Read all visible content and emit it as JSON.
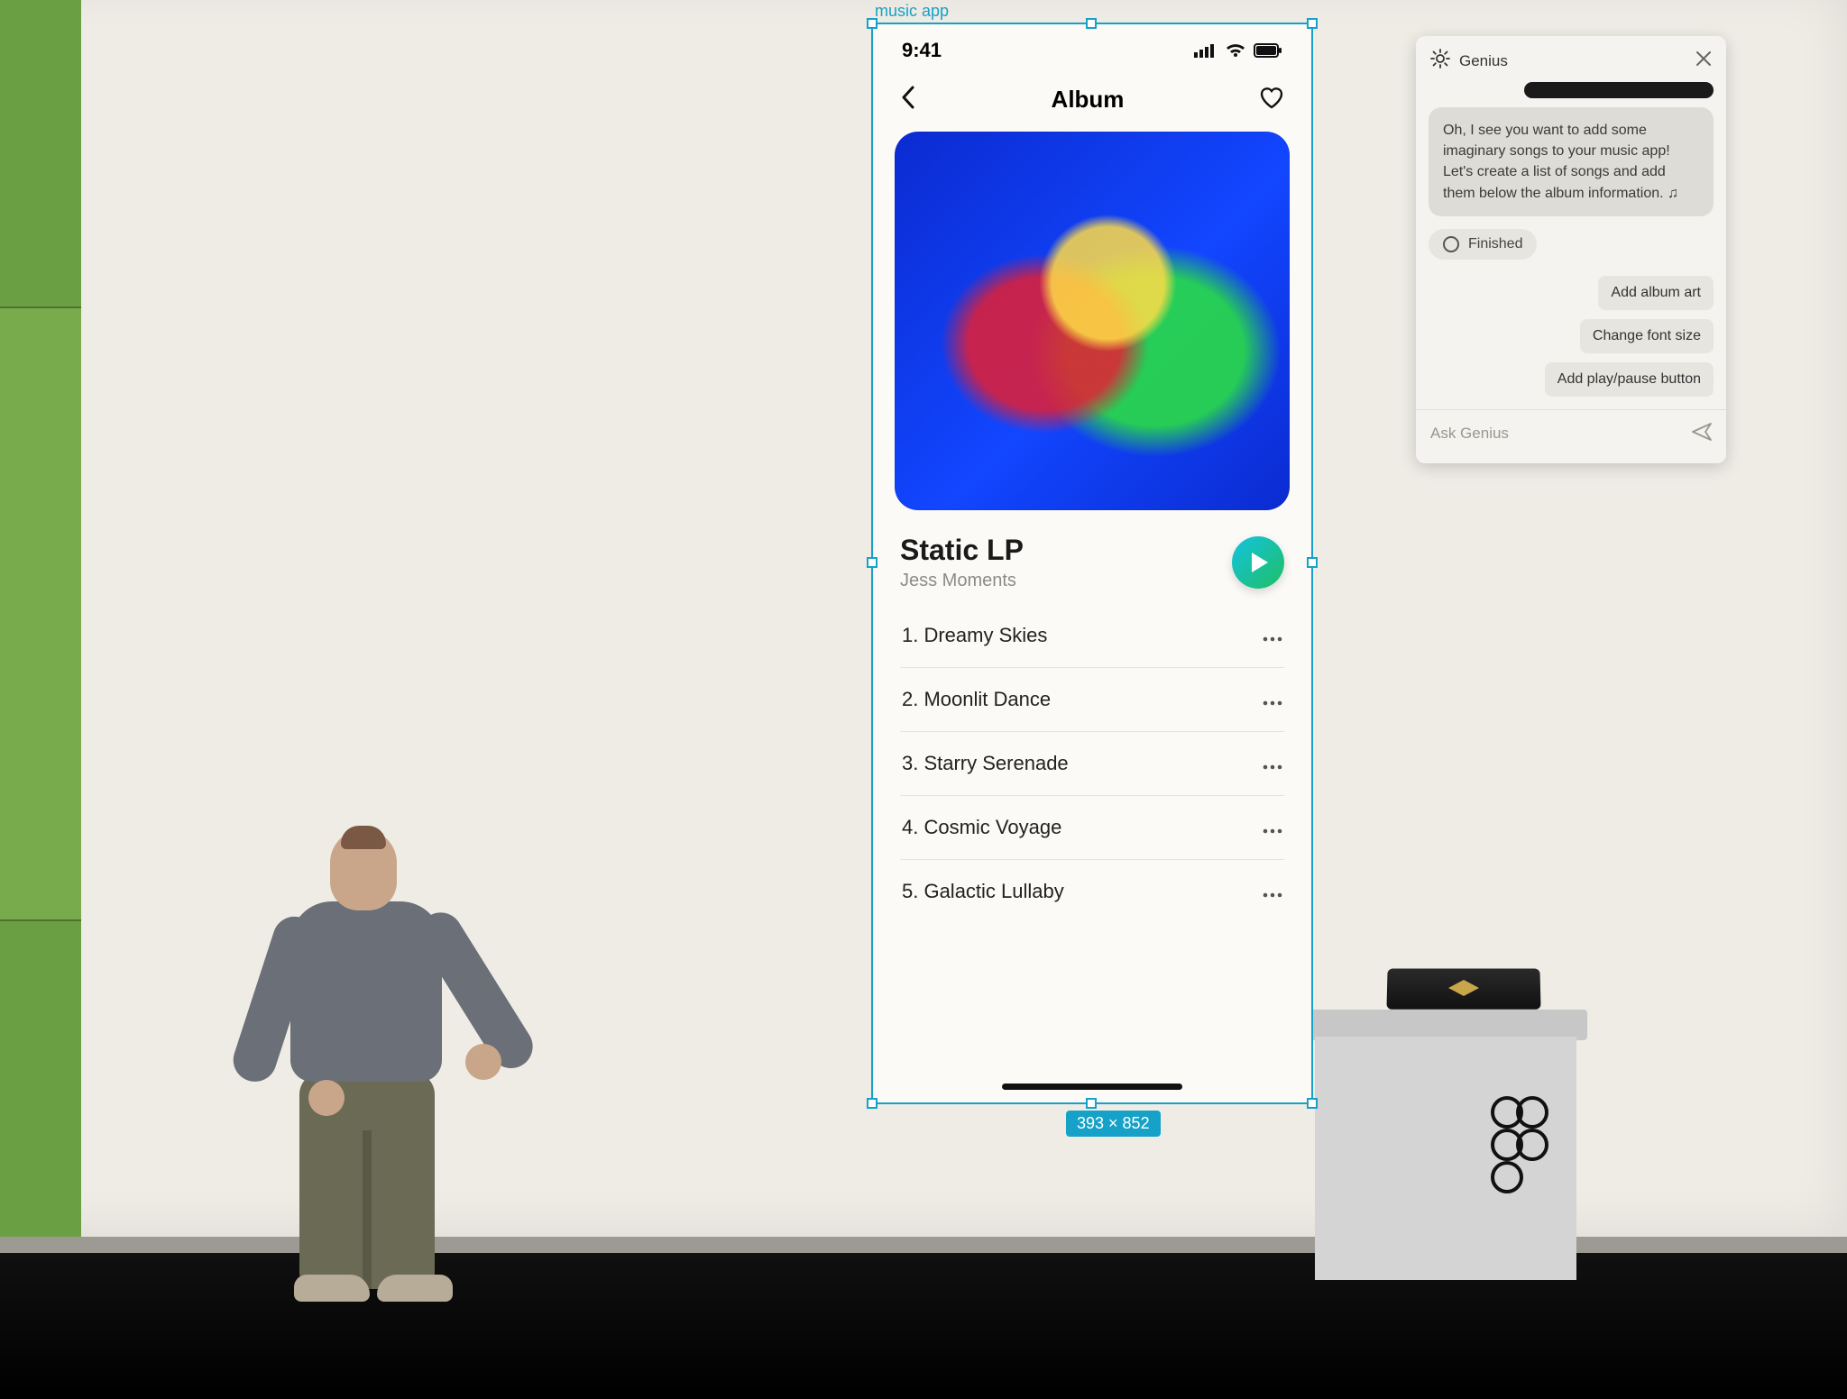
{
  "figma": {
    "frame_label": "music app",
    "frame_dimensions": "393 × 852"
  },
  "phone": {
    "status": {
      "time": "9:41"
    },
    "nav": {
      "title": "Album"
    },
    "album": {
      "title": "Static LP",
      "artist": "Jess Moments"
    },
    "tracks": [
      {
        "label": "1. Dreamy Skies"
      },
      {
        "label": "2. Moonlit Dance"
      },
      {
        "label": "3. Starry Serenade"
      },
      {
        "label": "4. Cosmic Voyage"
      },
      {
        "label": "5. Galactic Lullaby"
      }
    ]
  },
  "genius": {
    "title": "Genius",
    "message": "Oh, I see you want to add some imaginary songs to your music app! Let's create a list of songs and add them below the album information. ♫",
    "status": "Finished",
    "suggestions": [
      "Add album art",
      "Change font size",
      "Add play/pause button"
    ],
    "input_placeholder": "Ask Genius"
  }
}
